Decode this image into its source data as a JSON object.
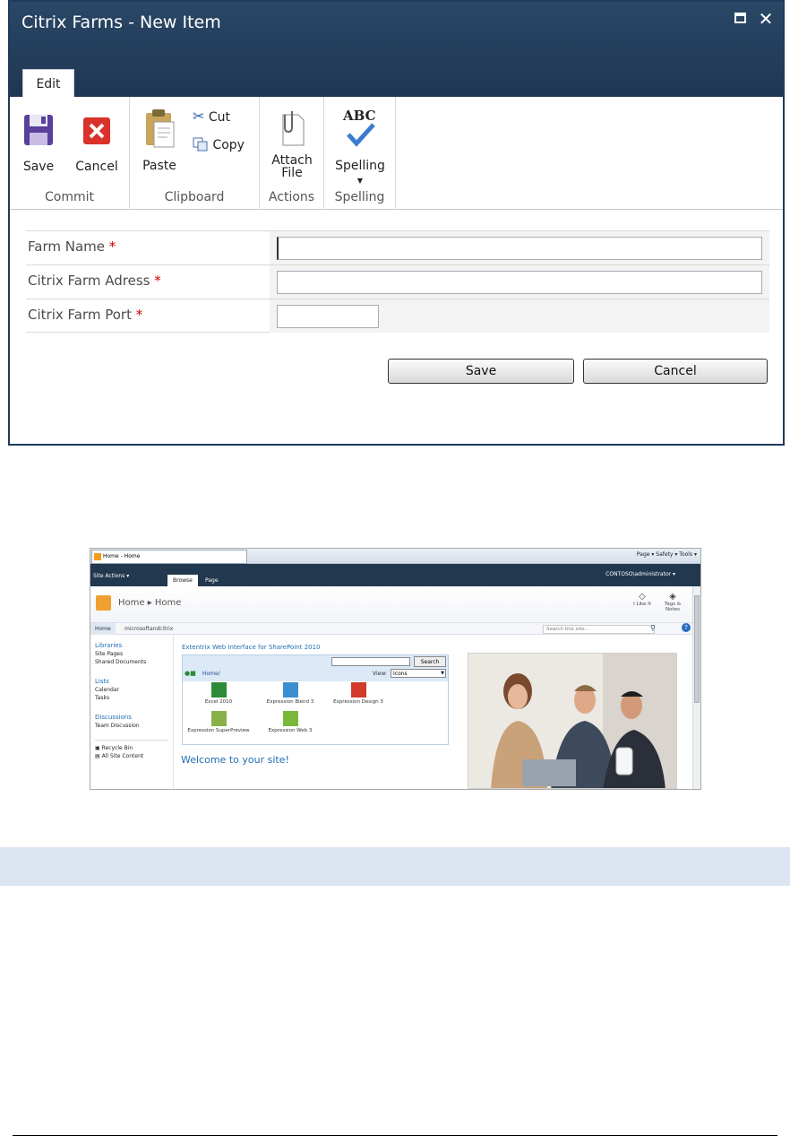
{
  "dialog": {
    "title": "Citrix Farms - New Item",
    "tab_label": "Edit",
    "ribbon": {
      "groups": [
        {
          "label": "Commit",
          "buttons": [
            "Save",
            "Cancel"
          ]
        },
        {
          "label": "Clipboard",
          "buttons": [
            "Paste",
            "Cut",
            "Copy"
          ]
        },
        {
          "label": "Actions",
          "buttons": [
            "Attach",
            "File"
          ]
        },
        {
          "label": "Spelling",
          "buttons": [
            "Spelling"
          ]
        }
      ],
      "spelling_icon_text": "ABC"
    },
    "form": {
      "fields": [
        {
          "label": "Farm Name",
          "required_mark": "*",
          "value": ""
        },
        {
          "label": "Citrix Farm Adress",
          "required_mark": "*",
          "value": ""
        },
        {
          "label": "Citrix Farm Port",
          "required_mark": "*",
          "value": ""
        }
      ],
      "save_label": "Save",
      "cancel_label": "Cancel"
    }
  },
  "sharepoint": {
    "browser_tab": "Home - Home",
    "browser_tools": "Page ▾  Safety ▾  Tools ▾",
    "site_actions": "Site Actions ▾",
    "tabs": [
      "Browse",
      "Page"
    ],
    "user": "CONTOSO\\administrator ▾",
    "breadcrumb": "Home ▸ Home",
    "like_label": "I Like It",
    "tags_label": "Tags & Notes",
    "nav_home": "Home",
    "nav_site": "microsoftandcitrix",
    "search_placeholder": "Search this site...",
    "quick_launch": {
      "libraries_heading": "Libraries",
      "libraries": [
        "Site Pages",
        "Shared Documents"
      ],
      "lists_heading": "Lists",
      "lists": [
        "Calendar",
        "Tasks"
      ],
      "discussions_heading": "Discussions",
      "discussions": [
        "Team Discussion"
      ],
      "recycle_bin": "Recycle Bin",
      "all_site_content": "All Site Content"
    },
    "webpart": {
      "title": "Extentrix Web Interface for SharePoint 2010",
      "search_button": "Search",
      "home_link": "Home/",
      "view_label": "View:",
      "view_value": "Icons",
      "apps": [
        "Excel 2010",
        "Expression Blend 3",
        "Expression Design 3",
        "Expression SuperPreview",
        "Expression Web 3"
      ]
    },
    "welcome": "Welcome to your site!",
    "colors": {
      "excel": "#2e8b3a",
      "blend": "#3a8fd0",
      "design": "#d23a2a",
      "superpreview": "#8ab04a",
      "web": "#7ab83c"
    }
  }
}
